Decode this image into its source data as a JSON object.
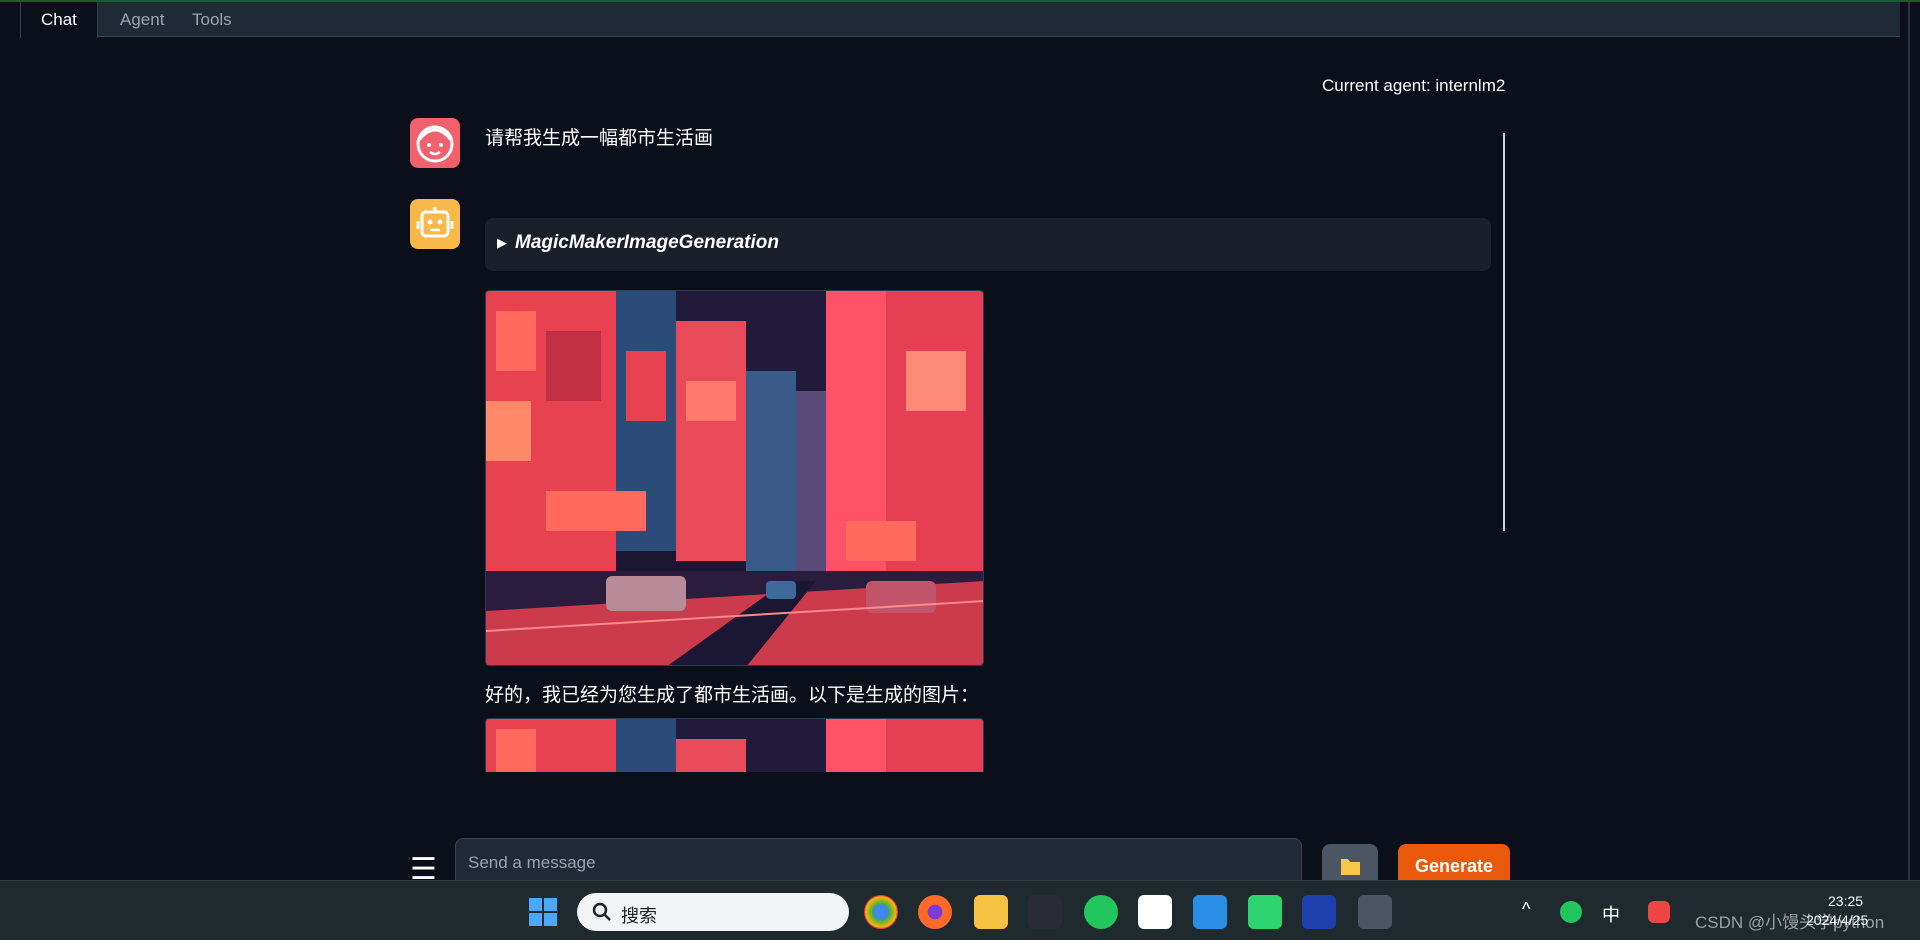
{
  "tabs": [
    {
      "label": "Chat",
      "active": true
    },
    {
      "label": "Agent",
      "active": false
    },
    {
      "label": "Tools",
      "active": false
    }
  ],
  "agent_label": "Current agent: internlm2",
  "messages": {
    "user_text": "请帮我生成一幅都市生活画",
    "tool_name": "MagicMakerImageGeneration",
    "reply_text": "好的，我已经为您生成了都市生活画。以下是生成的图片："
  },
  "input": {
    "placeholder": "Send a message"
  },
  "buttons": {
    "generate": "Generate"
  },
  "taskbar": {
    "search_placeholder": "搜索",
    "ime": "中",
    "time": "23:25",
    "date": "2024/4/25"
  },
  "watermark": "CSDN @小馒头学python",
  "colors": {
    "accent": "#ea580c",
    "background": "#0b0f19",
    "user_avatar": "#f0606d",
    "bot_avatar": "#f8b94a"
  }
}
